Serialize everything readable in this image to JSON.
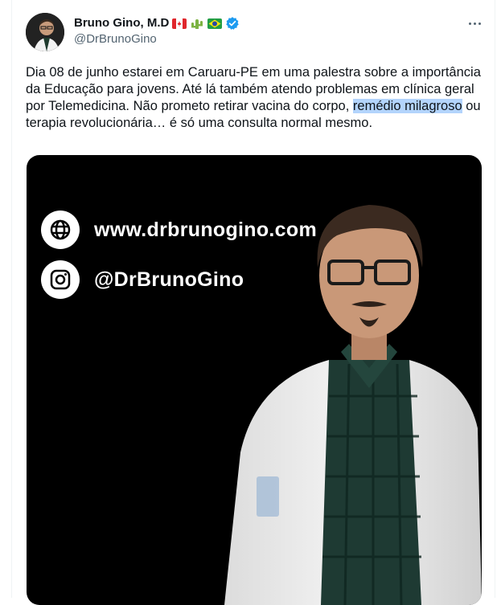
{
  "author": {
    "display_name": "Bruno Gino, M.D",
    "handle": "@DrBrunoGino",
    "flags": [
      "canada-flag",
      "cactus-emoji",
      "brazil-flag"
    ],
    "verified": true
  },
  "more_menu": "more-options",
  "tweet": {
    "text_before": "Dia 08 de junho estarei em Caruaru-PE em uma palestra sobre a importância da Educação para jovens. Até lá também atendo problemas em clínica geral por Telemedicina. Não prometo retirar vacina do corpo, ",
    "text_highlight": "remédio milagroso",
    "text_after": " ou terapia revolucionária… é só uma consulta normal mesmo."
  },
  "media": {
    "website": "www.drbrunogino.com",
    "instagram": "@DrBrunoGino",
    "icons": [
      "globe-icon",
      "instagram-icon"
    ]
  },
  "colors": {
    "highlight": "#b3d4fc",
    "verified_blue": "#1d9bf0",
    "text": "#0f1419",
    "muted": "#536471",
    "media_bg": "#000000"
  }
}
